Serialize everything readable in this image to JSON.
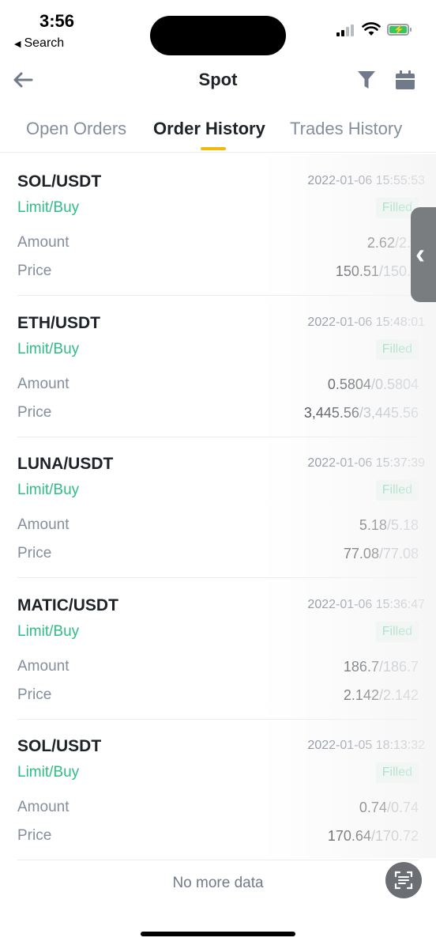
{
  "status_bar": {
    "time": "3:56",
    "back_app": "Search"
  },
  "header": {
    "title": "Spot"
  },
  "tabs": [
    {
      "label": "Open Orders"
    },
    {
      "label": "Order History"
    },
    {
      "label": "Trades History"
    }
  ],
  "orders": [
    {
      "pair": "SOL/USDT",
      "date": "2022-01-06 15:55:53",
      "side": "Limit/Buy",
      "status": "Filled",
      "amount_label": "Amount",
      "amount_filled": "2.62",
      "amount_total": "/2.6",
      "price_label": "Price",
      "price_avg": "150.51",
      "price_order": "/150.6"
    },
    {
      "pair": "ETH/USDT",
      "date": "2022-01-06 15:48:01",
      "side": "Limit/Buy",
      "status": "Filled",
      "amount_label": "Amount",
      "amount_filled": "0.5804",
      "amount_total": "/0.5804",
      "price_label": "Price",
      "price_avg": "3,445.56",
      "price_order": "/3,445.56"
    },
    {
      "pair": "LUNA/USDT",
      "date": "2022-01-06 15:37:39",
      "side": "Limit/Buy",
      "status": "Filled",
      "amount_label": "Amount",
      "amount_filled": "5.18",
      "amount_total": "/5.18",
      "price_label": "Price",
      "price_avg": "77.08",
      "price_order": "/77.08"
    },
    {
      "pair": "MATIC/USDT",
      "date": "2022-01-06 15:36:47",
      "side": "Limit/Buy",
      "status": "Filled",
      "amount_label": "Amount",
      "amount_filled": "186.7",
      "amount_total": "/186.7",
      "price_label": "Price",
      "price_avg": "2.142",
      "price_order": "/2.142"
    },
    {
      "pair": "SOL/USDT",
      "date": "2022-01-05 18:13:32",
      "side": "Limit/Buy",
      "status": "Filled",
      "amount_label": "Amount",
      "amount_filled": "0.74",
      "amount_total": "/0.74",
      "price_label": "Price",
      "price_avg": "170.64",
      "price_order": "/170.72"
    }
  ],
  "footer": {
    "no_more": "No more data"
  },
  "colors": {
    "accent": "#f0b90b",
    "buy_green": "#2ebd85",
    "muted": "#848e9c",
    "text": "#1e2329"
  },
  "icons": [
    "back-arrow-icon",
    "filter-icon",
    "calendar-icon",
    "scan-icon",
    "side-handle-chevron-icon"
  ]
}
